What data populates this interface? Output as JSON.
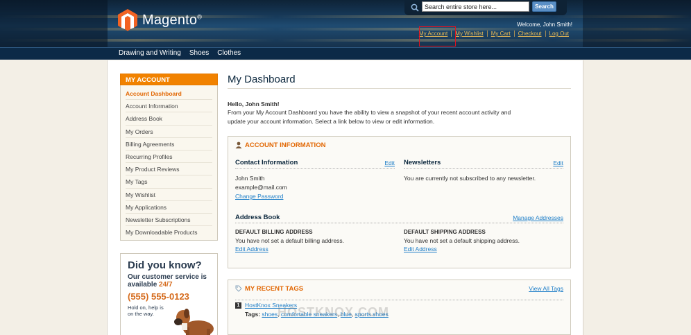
{
  "header": {
    "logo_text": "Magento",
    "logo_reg": "®",
    "search_placeholder": "Search entire store here...",
    "search_button": "Search",
    "welcome": "Welcome, John Smith!",
    "links": [
      "My Account",
      "My Wishlist",
      "My Cart",
      "Checkout",
      "Log Out"
    ]
  },
  "nav": [
    "Drawing and Writing",
    "Shoes",
    "Clothes"
  ],
  "sidebar": {
    "title": "MY ACCOUNT",
    "items": [
      "Account Dashboard",
      "Account Information",
      "Address Book",
      "My Orders",
      "Billing Agreements",
      "Recurring Profiles",
      "My Product Reviews",
      "My Tags",
      "My Wishlist",
      "My Applications",
      "Newsletter Subscriptions",
      "My Downloadable Products"
    ]
  },
  "promo": {
    "line1": "Did you know?",
    "line2a": "Our customer service is",
    "line2b": "available",
    "line2c": "24/7",
    "phone": "(555) 555-0123",
    "line4": "Hold on, help is on the way."
  },
  "main": {
    "title": "My Dashboard",
    "hello": "Hello, John Smith!",
    "intro": "From your My Account Dashboard you have the ability to view a snapshot of your recent account activity and update your account information. Select a link below to view or edit information."
  },
  "account_info": {
    "title": "ACCOUNT INFORMATION",
    "contact_title": "Contact Information",
    "edit": "Edit",
    "name": "John Smith",
    "email": "example@mail.com",
    "change_password": "Change Password",
    "newsletters_title": "Newsletters",
    "newsletter_text": "You are currently not subscribed to any newsletter.",
    "address_title": "Address Book",
    "manage_addresses": "Manage Addresses",
    "billing_title": "DEFAULT BILLING ADDRESS",
    "billing_text": "You have not set a default billing address.",
    "shipping_title": "DEFAULT SHIPPING ADDRESS",
    "shipping_text": "You have not set a default shipping address.",
    "edit_address": "Edit Address"
  },
  "recent_tags": {
    "title": "MY RECENT TAGS",
    "view_all": "View All Tags",
    "item_number": "1",
    "product": "HostKnox Sneakers",
    "tags_label": "Tags:",
    "tags": [
      "shoes",
      "comfortable sneakers",
      "blue",
      "sports shoes"
    ]
  },
  "watermark": "HOSTKNOX.COM",
  "colors": {
    "accent": "#f18200",
    "link": "#1e7ec8",
    "header_link": "#ebbb55",
    "highlight": "#e0121f"
  }
}
